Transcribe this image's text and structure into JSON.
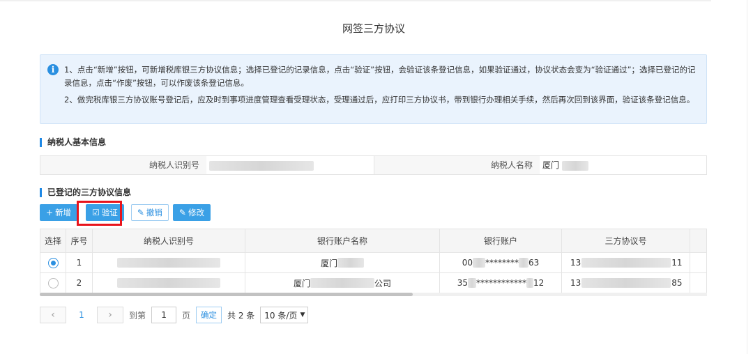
{
  "page": {
    "title": "网签三方协议"
  },
  "notice": {
    "line1": "1、点击“新增”按钮，可新增税库银三方协议信息；选择已登记的记录信息，点击“验证”按钮，会验证该条登记信息，如果验证通过，协议状态会变为“验证通过”；选择已登记的记录信息，点击“作废”按钮，可以作废该条登记信息。",
    "line2": "2、做完税库银三方协议账号登记后，应及时到事项进度管理查看受理状态，受理通过后，应打印三方协议书，带到银行办理相关手续，然后再次回到该界面，验证该条登记信息。"
  },
  "taxpayer": {
    "section_title": "纳税人基本信息",
    "id_label": "纳税人识别号",
    "name_label": "纳税人名称",
    "name_value": "厦门"
  },
  "agreements": {
    "section_title": "已登记的三方协议信息",
    "toolbar": {
      "add": "新增",
      "verify": "验证",
      "revoke": "撤销",
      "modify": "修改"
    },
    "columns": [
      "选择",
      "序号",
      "纳税人识别号",
      "银行账户名称",
      "银行账户",
      "三方协议号"
    ],
    "rows": [
      {
        "seq": "1",
        "account_name_prefix": "厦门",
        "account_name_suffix": "",
        "account_a": "00",
        "account_mask": "********",
        "account_b": "63",
        "agreement_a": "13",
        "agreement_b": "11",
        "selected": true
      },
      {
        "seq": "2",
        "account_name_prefix": "厦门",
        "account_name_suffix": "公司",
        "account_a": "35",
        "account_mask": "************",
        "account_b": "12",
        "agreement_a": "13",
        "agreement_b": "85",
        "selected": false
      }
    ]
  },
  "pager": {
    "current_page": "1",
    "goto_label": "到第",
    "goto_value": "1",
    "page_label": "页",
    "confirm": "确定",
    "total": "共 2 条",
    "page_size": "10 条/页"
  }
}
